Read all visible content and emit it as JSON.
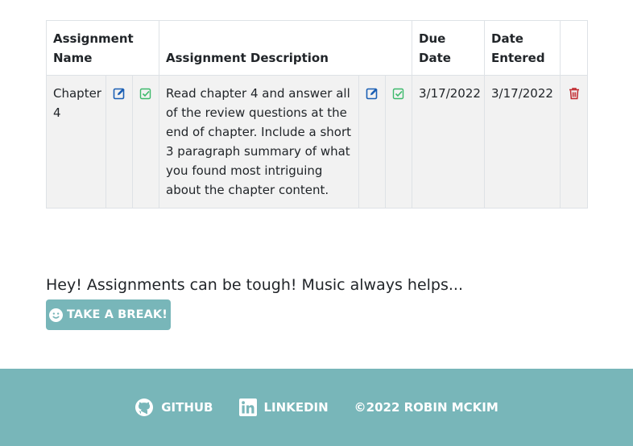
{
  "table": {
    "headers": {
      "name": "Assignment Name",
      "description": "Assignment Description",
      "due_date": "Due Date",
      "date_entered": "Date Entered"
    },
    "rows": [
      {
        "name": "Chapter 4",
        "description": "Read chapter 4 and answer all of the review questions at the end of chapter. Include a short 3 paragraph summary of what you found most intriguing about the chapter content.",
        "due_date": "3/17/2022",
        "date_entered": "3/17/2022"
      }
    ]
  },
  "music": {
    "text": "Hey! Assignments can be tough! Music always helps...",
    "button_label": "TAKE A BREAK!"
  },
  "footer": {
    "github_label": "GITHUB",
    "linkedin_label": "LINKEDIN",
    "copyright": "©2022 ROBIN MCKIM"
  },
  "colors": {
    "accent": "#78b6b9",
    "edit_icon": "#1b5fb4",
    "check_icon": "#3cb96b",
    "delete_icon": "#c0282d"
  },
  "icons": {
    "edit": "edit-icon",
    "confirm": "check-square-icon",
    "delete": "trash-icon",
    "smile": "smile-icon",
    "github": "github-icon",
    "linkedin": "linkedin-icon"
  }
}
